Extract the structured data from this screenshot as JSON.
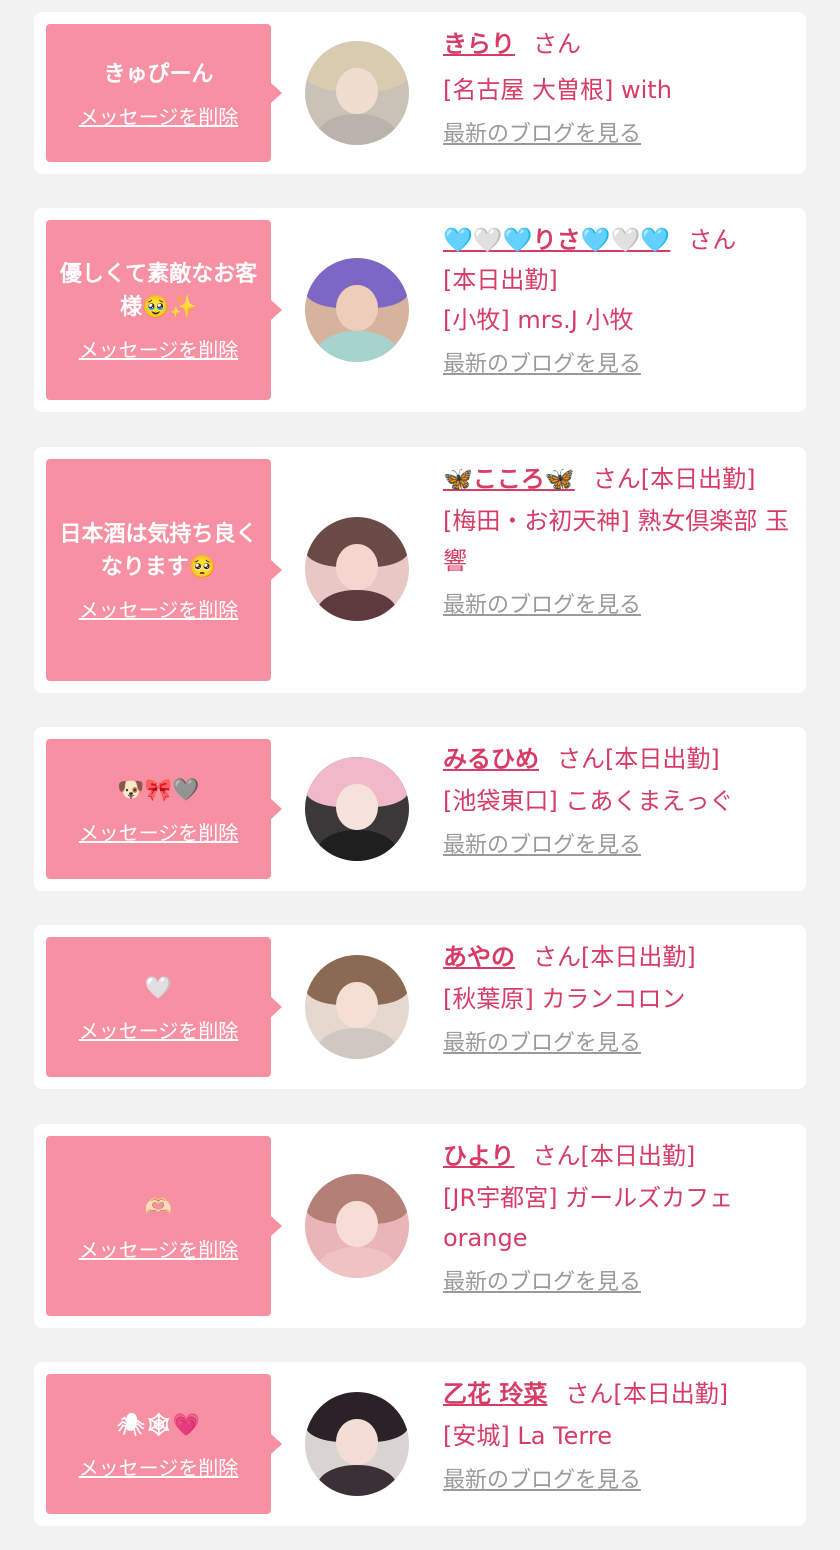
{
  "colors": {
    "background": "#f2f2f2",
    "card": "#ffffff",
    "bubble": "#f890a3",
    "accent": "#d63c66",
    "link_gray": "#9a9a9a"
  },
  "delete_label": "メッセージを削除",
  "blog_label": "最新のブログを見る",
  "honorific": "さん",
  "items": [
    {
      "message": "きゅぴーん",
      "name": "きらり",
      "status": "",
      "shop": "[名古屋 大曽根] with"
    },
    {
      "message": "優しくて素敵なお客様🥹✨",
      "name": "🩵🤍🩵りさ🩵🤍🩵",
      "status": "[本日出勤]",
      "shop": "[小牧] mrs.J 小牧"
    },
    {
      "message": "日本酒は気持ち良くなります🥺",
      "name": "🦋こころ🦋",
      "status": "[本日出勤]",
      "shop": "[梅田・お初天神] 熟女倶楽部 玉響"
    },
    {
      "message": "🐶🎀🩶",
      "name": "みるひめ",
      "status": "[本日出勤]",
      "shop": "[池袋東口] こあくまえっぐ"
    },
    {
      "message": "🤍",
      "name": "あやの",
      "status": "[本日出勤]",
      "shop": "[秋葉原] カランコロン"
    },
    {
      "message": "🫶🏻",
      "name": "ひより",
      "status": "[本日出勤]",
      "shop": "[JR宇都宮] ガールズカフェorange"
    },
    {
      "message": "🕷🕸💗",
      "name": "乙花 玲菜",
      "status": "[本日出勤]",
      "shop": "[安城] La Terre"
    }
  ]
}
